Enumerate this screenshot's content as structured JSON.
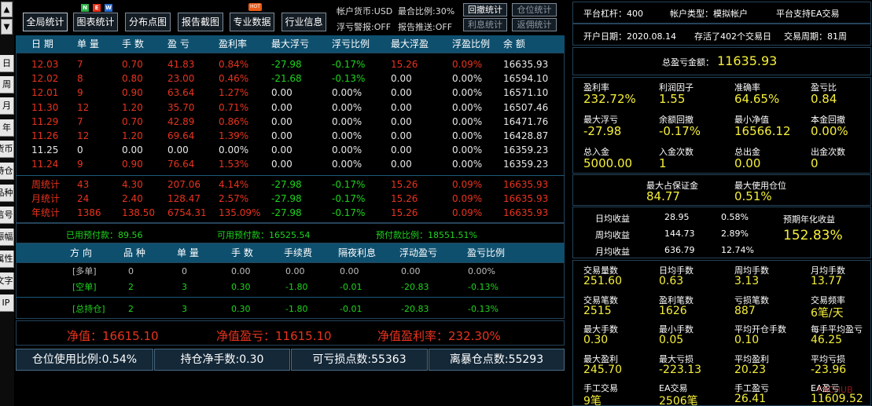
{
  "side": {
    "up_arrow": "▲",
    "down_arrow": "▼",
    "tabs": [
      "日",
      "周",
      "月",
      "年",
      "货币",
      "持仓",
      "品种",
      "信号",
      "振幅",
      "属性",
      "文字",
      "IP"
    ]
  },
  "toolbar": {
    "buttons": [
      "全局统计",
      "图表统计",
      "分布点图",
      "报告截图",
      "专业数据",
      "行业信息"
    ],
    "new_badge": [
      "N",
      "E",
      "W"
    ],
    "hot_badge": "HOT",
    "account_currency": "帐户货币:USD",
    "float_warning": "浮亏警报:OFF",
    "position_ratio": "最合比例:30%",
    "report_push": "报告推送:OFF",
    "drawdown_stats": "回撤统计",
    "position_stats": "仓位统计",
    "interest_stats": "利息统计",
    "commission_stats": "返佣统计"
  },
  "stats_table": {
    "headers": [
      "日 期",
      "单 量",
      "手 数",
      "盈 亏",
      "盈利率",
      "最大浮亏",
      "浮亏比例",
      "最大浮盈",
      "浮盈比例",
      "余 额"
    ],
    "rows": [
      [
        "12.03",
        "7",
        "0.70",
        "41.83",
        "0.84%",
        "-27.98",
        "-0.17%",
        "15.26",
        "0.09%",
        "16635.93"
      ],
      [
        "12.02",
        "8",
        "0.80",
        "23.00",
        "0.46%",
        "-21.68",
        "-0.13%",
        "0.00",
        "0.00%",
        "16594.10"
      ],
      [
        "12.01",
        "9",
        "0.90",
        "63.64",
        "1.27%",
        "0.00",
        "0.00%",
        "0.00",
        "0.00%",
        "16571.10"
      ],
      [
        "11.30",
        "12",
        "1.20",
        "35.70",
        "0.71%",
        "0.00",
        "0.00%",
        "0.00",
        "0.00%",
        "16507.46"
      ],
      [
        "11.29",
        "7",
        "0.70",
        "42.89",
        "0.86%",
        "0.00",
        "0.00%",
        "0.00",
        "0.00%",
        "16471.76"
      ],
      [
        "11.26",
        "12",
        "1.20",
        "69.64",
        "1.39%",
        "0.00",
        "0.00%",
        "0.00",
        "0.00%",
        "16428.87"
      ],
      [
        "11.25",
        "0",
        "0.00",
        "0.00",
        "0.00%",
        "0.00",
        "0.00%",
        "0.00",
        "0.00%",
        "16359.23"
      ],
      [
        "11.24",
        "9",
        "0.90",
        "76.64",
        "1.53%",
        "0.00",
        "0.00%",
        "0.00",
        "0.00%",
        "16359.23"
      ]
    ],
    "summary": [
      [
        "周统计",
        "43",
        "4.30",
        "207.06",
        "4.14%",
        "-27.98",
        "-0.17%",
        "15.26",
        "0.09%",
        "16635.93"
      ],
      [
        "月统计",
        "24",
        "2.40",
        "128.47",
        "2.57%",
        "-27.98",
        "-0.17%",
        "15.26",
        "0.09%",
        "16635.93"
      ],
      [
        "年统计",
        "1386",
        "138.50",
        "6754.31",
        "135.09%",
        "-27.98",
        "-0.17%",
        "15.26",
        "0.09%",
        "16635.93"
      ]
    ]
  },
  "margin": {
    "used": "已用预付款：89.56",
    "available": "可用预付款：16525.54",
    "ratio": "预付款比例：18551.51%"
  },
  "positions": {
    "headers": [
      "方 向",
      "品 种",
      "单 量",
      "手 数",
      "手续费",
      "隔夜利息",
      "浮动盈亏",
      "盈亏比例"
    ],
    "rows": [
      [
        "[多单]",
        "0",
        "0",
        "0.00",
        "0.00",
        "0.00",
        "0.00",
        "0.00%"
      ],
      [
        "[空单]",
        "2",
        "3",
        "0.30",
        "-1.80",
        "-0.01",
        "-20.83",
        "-0.13%"
      ],
      [
        "[总持仓]",
        "2",
        "3",
        "0.30",
        "-1.80",
        "-0.01",
        "-20.83",
        "-0.13%"
      ]
    ]
  },
  "net": {
    "equity": "净值：16615.10",
    "equity_pnl": "净值盈亏：11615.10",
    "equity_rate": "净值盈利率：232.30%"
  },
  "bottom": {
    "usage": "仓位使用比例:0.54%",
    "net_lots": "持仓净手数:0.30",
    "sl_points": "可亏损点数:55363",
    "liquidation": "离暴仓点数:55293"
  },
  "right": {
    "platform_leverage": "平台杠杆：400",
    "account_type": "帐户类型：模拟帐户",
    "ea_support": "平台支持EA交易",
    "open_date": "开户日期：2020.08.14",
    "survived": "存活了402个交易日",
    "trade_cycle": "交易周期：81周",
    "total_pnl_label": "总盈亏金额：",
    "total_pnl_value": "11635.93",
    "grid1": [
      [
        "盈利率",
        "232.72%"
      ],
      [
        "利润因子",
        "1.55"
      ],
      [
        "准确率",
        "64.65%"
      ],
      [
        "盈亏比",
        "0.84"
      ],
      [
        "最大浮亏",
        "-27.98"
      ],
      [
        "余额回撤",
        "-0.17%"
      ],
      [
        "最小净值",
        "16566.12"
      ],
      [
        "本金回撤",
        "0.00%"
      ],
      [
        "总入金",
        "5000.00"
      ],
      [
        "入金次数",
        "1"
      ],
      [
        "总出金",
        "0.00"
      ],
      [
        "出金次数",
        "0"
      ]
    ],
    "margin_max_label": "最大占保证金",
    "margin_max_value": "84.77",
    "max_use_label": "最大使用仓位",
    "max_use_value": "0.51%",
    "income": [
      [
        "日均收益",
        "28.95",
        "0.58%"
      ],
      [
        "周均收益",
        "144.73",
        "2.89%"
      ],
      [
        "月均收益",
        "636.79",
        "12.74%"
      ]
    ],
    "annual_label": "预期年化收益",
    "annual_value": "152.83%",
    "grid2": [
      [
        "交易量数",
        "251.60"
      ],
      [
        "日均手数",
        "0.63"
      ],
      [
        "周均手数",
        "3.13"
      ],
      [
        "月均手数",
        "13.77"
      ],
      [
        "交易笔数",
        "2515"
      ],
      [
        "盈利笔数",
        "1626"
      ],
      [
        "亏损笔数",
        "887"
      ],
      [
        "交易频率",
        "6笔/天"
      ],
      [
        "最大手数",
        "0.30"
      ],
      [
        "最小手数",
        "0.05"
      ],
      [
        "平均开仓手数",
        "0.10"
      ],
      [
        "每手平均盈亏",
        "46.25"
      ],
      [
        "最大盈利",
        "245.70"
      ],
      [
        "最大亏损",
        "-223.13"
      ],
      [
        "平均盈利",
        "20.23"
      ],
      [
        "平均亏损",
        "-23.96"
      ],
      [
        "手工交易",
        "9笔"
      ],
      [
        "EA交易",
        "2506笔"
      ],
      [
        "手工盈亏",
        "26.41"
      ],
      [
        "EA盈亏",
        "11609.52"
      ]
    ],
    "watermark": "FXCHUB"
  },
  "colors": {
    "header_bg": "#0e4f6e",
    "red": "#e8331e",
    "green": "#1ed51e",
    "yellow": "#f5ef3a"
  }
}
